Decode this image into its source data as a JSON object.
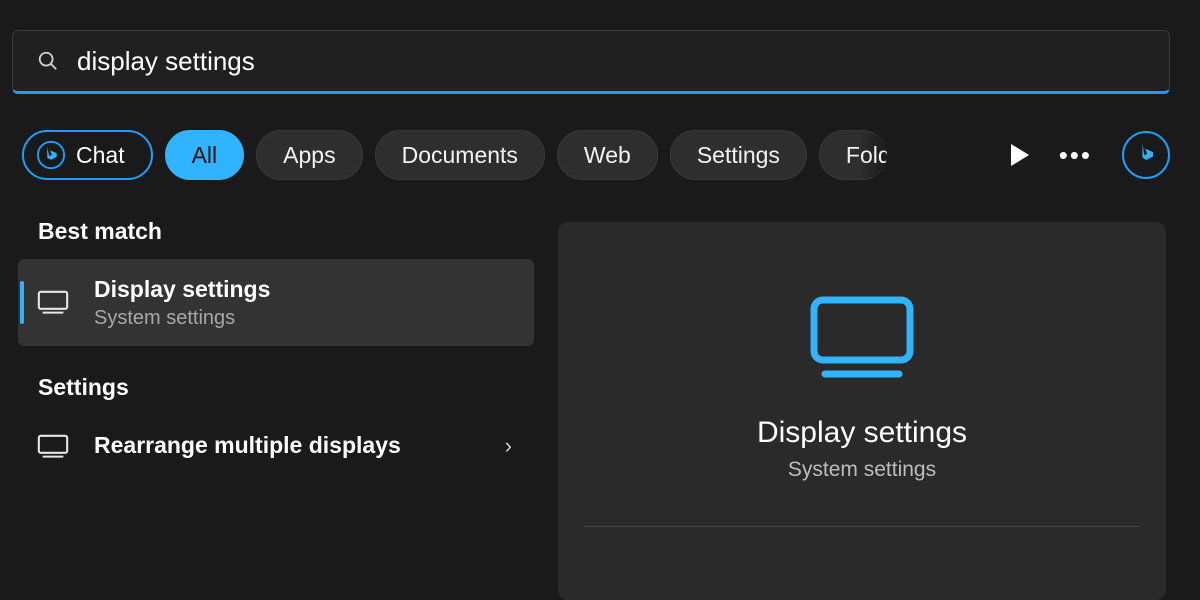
{
  "search": {
    "query": "display settings"
  },
  "filters": {
    "chat": "Chat",
    "all": "All",
    "apps": "Apps",
    "documents": "Documents",
    "web": "Web",
    "settings": "Settings",
    "folders_truncated": "Fold"
  },
  "top_actions": {
    "more": "•••"
  },
  "left": {
    "best_match_header": "Best match",
    "settings_header": "Settings",
    "best_match": {
      "title": "Display settings",
      "subtitle": "System settings"
    },
    "settings_items": [
      {
        "title_prefix": "Rearrange multiple ",
        "title_bold": "display",
        "title_suffix": "s"
      }
    ]
  },
  "preview": {
    "title": "Display settings",
    "subtitle": "System settings"
  },
  "colors": {
    "accent": "#30b4ff",
    "accent_border": "#1a9fff"
  }
}
